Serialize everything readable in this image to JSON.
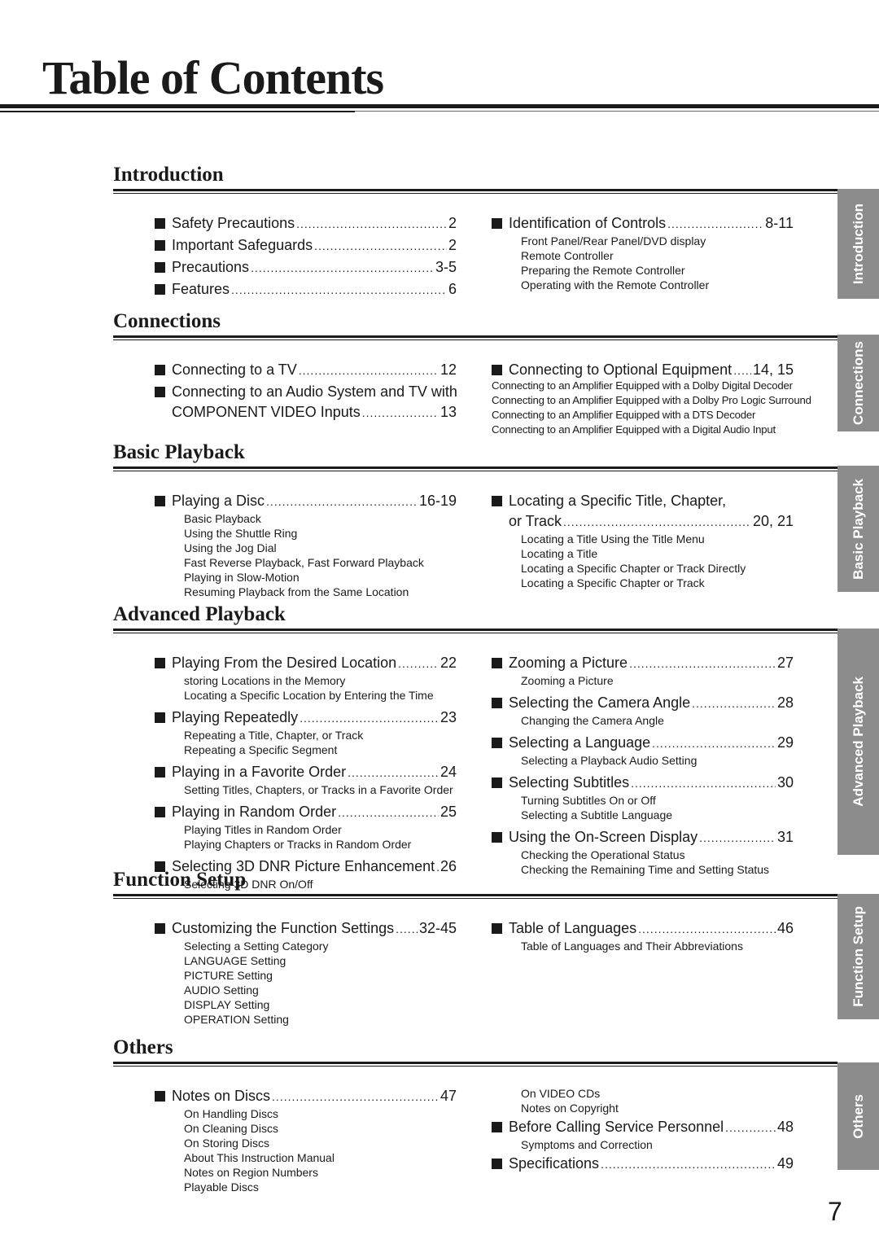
{
  "title": "Table of Contents",
  "page_number": "7",
  "tab_color": "#8c8c8c",
  "sections": [
    {
      "heading": "Introduction",
      "tab": "Introduction",
      "left": [
        {
          "type": "main",
          "text": "Safety Precautions",
          "page": "2"
        },
        {
          "type": "main",
          "text": "Important Safeguards",
          "page": "2"
        },
        {
          "type": "main",
          "text": "Precautions",
          "page": "3-5"
        },
        {
          "type": "main",
          "text": "Features",
          "page": "6"
        }
      ],
      "right": [
        {
          "type": "main",
          "text": "Identification of Controls",
          "page": "8-11"
        },
        {
          "type": "sub",
          "text": "Front Panel/Rear Panel/DVD display"
        },
        {
          "type": "sub",
          "text": "Remote Controller"
        },
        {
          "type": "sub",
          "text": "Preparing the Remote Controller"
        },
        {
          "type": "sub",
          "text": "Operating with the Remote Controller"
        }
      ]
    },
    {
      "heading": "Connections",
      "tab": "Connections",
      "left": [
        {
          "type": "main",
          "text": "Connecting to a TV",
          "page": "12"
        },
        {
          "type": "main",
          "text": "Connecting to an Audio System and TV with"
        },
        {
          "type": "cont",
          "text": "COMPONENT VIDEO Inputs",
          "page": "13"
        }
      ],
      "right": [
        {
          "type": "main",
          "text": "Connecting to Optional Equipment",
          "page": "14, 15"
        },
        {
          "type": "flat",
          "text": "Connecting to an Amplifier Equipped with a Dolby Digital Decoder"
        },
        {
          "type": "flat",
          "text": "Connecting to an Amplifier Equipped with a Dolby Pro Logic Surround"
        },
        {
          "type": "flat",
          "text": "Connecting to an Amplifier Equipped with a DTS Decoder"
        },
        {
          "type": "flat",
          "text": "Connecting to an Amplifier Equipped with a Digital Audio Input"
        }
      ]
    },
    {
      "heading": "Basic Playback",
      "tab": "Basic Playback",
      "left": [
        {
          "type": "main",
          "text": "Playing a Disc",
          "page": "16-19"
        },
        {
          "type": "sub",
          "text": "Basic Playback"
        },
        {
          "type": "sub",
          "text": "Using the Shuttle Ring"
        },
        {
          "type": "sub",
          "text": "Using the Jog Dial"
        },
        {
          "type": "sub",
          "text": "Fast Reverse Playback, Fast Forward Playback"
        },
        {
          "type": "sub",
          "text": "Playing in Slow-Motion"
        },
        {
          "type": "sub",
          "text": "Resuming Playback from the Same Location"
        }
      ],
      "right": [
        {
          "type": "main",
          "text": "Locating a Specific Title, Chapter,"
        },
        {
          "type": "cont",
          "text": "or Track",
          "page": "20, 21"
        },
        {
          "type": "sub",
          "text": "Locating a Title Using the Title Menu"
        },
        {
          "type": "sub",
          "text": "Locating a Title"
        },
        {
          "type": "sub",
          "text": "Locating a Specific Chapter or Track Directly"
        },
        {
          "type": "sub",
          "text": "Locating a Specific Chapter or Track"
        }
      ]
    },
    {
      "heading": "Advanced Playback",
      "tab": "Advanced Playback",
      "left": [
        {
          "type": "main",
          "text": "Playing From the Desired Location",
          "page": "22"
        },
        {
          "type": "sub",
          "text": "storing Locations in the Memory"
        },
        {
          "type": "sub",
          "text": "Locating a Specific Location by Entering the Time"
        },
        {
          "type": "main",
          "text": "Playing Repeatedly",
          "page": "23"
        },
        {
          "type": "sub",
          "text": "Repeating a Title, Chapter, or Track"
        },
        {
          "type": "sub",
          "text": "Repeating a Specific Segment"
        },
        {
          "type": "main",
          "text": "Playing in a Favorite Order",
          "page": "24"
        },
        {
          "type": "sub",
          "text": "Setting Titles, Chapters, or Tracks in a Favorite Order"
        },
        {
          "type": "main",
          "text": "Playing in Random Order",
          "page": "25"
        },
        {
          "type": "sub",
          "text": "Playing Titles in Random Order"
        },
        {
          "type": "sub",
          "text": "Playing Chapters or Tracks in Random Order"
        },
        {
          "type": "main",
          "text": "Selecting 3D DNR Picture Enhancement",
          "page": "26"
        },
        {
          "type": "sub",
          "text": "Selecting 3D DNR On/Off"
        }
      ],
      "right": [
        {
          "type": "main",
          "text": "Zooming a Picture",
          "page": "27"
        },
        {
          "type": "sub",
          "text": "Zooming a Picture"
        },
        {
          "type": "main",
          "text": "Selecting the Camera Angle",
          "page": "28"
        },
        {
          "type": "sub",
          "text": "Changing the Camera Angle"
        },
        {
          "type": "main",
          "text": "Selecting a Language",
          "page": "29"
        },
        {
          "type": "sub",
          "text": "Selecting a Playback Audio Setting"
        },
        {
          "type": "main",
          "text": "Selecting Subtitles",
          "page": "30"
        },
        {
          "type": "sub",
          "text": "Turning Subtitles On or Off"
        },
        {
          "type": "sub",
          "text": "Selecting a Subtitle Language"
        },
        {
          "type": "main",
          "text": "Using the On-Screen Display",
          "page": "31"
        },
        {
          "type": "sub",
          "text": "Checking the Operational Status"
        },
        {
          "type": "sub",
          "text": "Checking the Remaining Time and Setting Status"
        }
      ]
    },
    {
      "heading": "Function Setup",
      "tab": "Function Setup",
      "left": [
        {
          "type": "main",
          "text": "Customizing the Function Settings",
          "page": "32-45"
        },
        {
          "type": "sub",
          "text": "Selecting a Setting Category"
        },
        {
          "type": "sub",
          "text": "LANGUAGE Setting"
        },
        {
          "type": "sub",
          "text": "PICTURE Setting"
        },
        {
          "type": "sub",
          "text": "AUDIO Setting"
        },
        {
          "type": "sub",
          "text": "DISPLAY Setting"
        },
        {
          "type": "sub",
          "text": "OPERATION Setting"
        }
      ],
      "right": [
        {
          "type": "main",
          "text": "Table of Languages",
          "page": "46"
        },
        {
          "type": "sub",
          "text": "Table of Languages and Their Abbreviations"
        }
      ]
    },
    {
      "heading": "Others",
      "tab": "Others",
      "left": [
        {
          "type": "main",
          "text": "Notes on Discs",
          "page": "47"
        },
        {
          "type": "sub",
          "text": "On Handling Discs"
        },
        {
          "type": "sub",
          "text": "On Cleaning Discs"
        },
        {
          "type": "sub",
          "text": "On Storing Discs"
        },
        {
          "type": "sub",
          "text": "About This Instruction Manual"
        },
        {
          "type": "sub",
          "text": "Notes on Region Numbers"
        },
        {
          "type": "sub",
          "text": "Playable Discs"
        }
      ],
      "right": [
        {
          "type": "sub",
          "text": "On VIDEO CDs"
        },
        {
          "type": "sub",
          "text": "Notes on Copyright"
        },
        {
          "type": "main",
          "text": "Before Calling Service Personnel",
          "page": "48"
        },
        {
          "type": "sub",
          "text": "Symptoms and Correction"
        },
        {
          "type": "main",
          "text": "Specifications",
          "page": "49"
        }
      ]
    }
  ]
}
